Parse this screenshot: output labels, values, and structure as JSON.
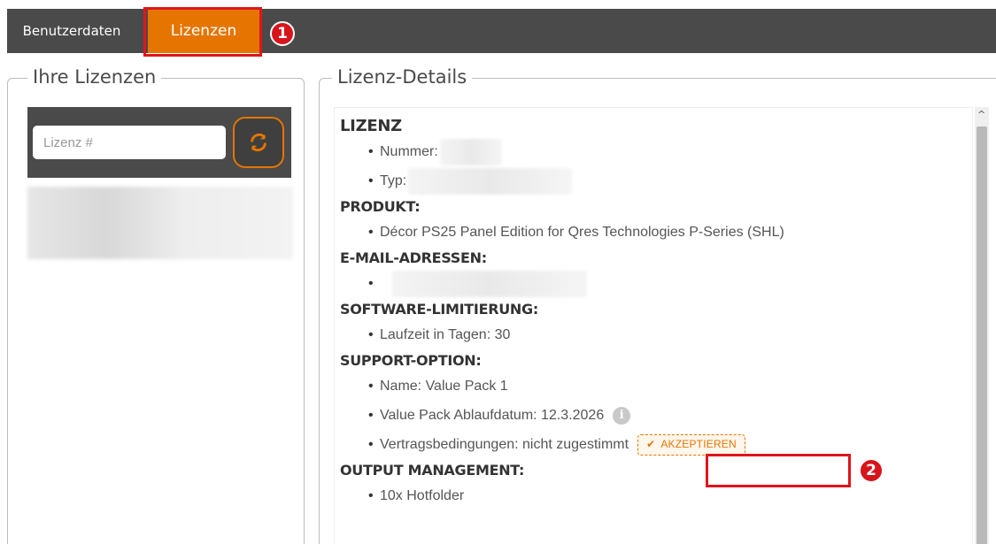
{
  "tabs": {
    "user_data": "Benutzerdaten",
    "licenses": "Lizenzen"
  },
  "markers": {
    "one": "1",
    "two": "2"
  },
  "left_panel": {
    "legend": "Ihre Lizenzen",
    "search_placeholder": "Lizenz #",
    "refresh_icon": "refresh-icon"
  },
  "right_panel": {
    "legend": "Lizenz-Details",
    "license": {
      "title": "LIZENZ",
      "number_label": "Nummer:",
      "type_label": "Typ:"
    },
    "product": {
      "title": "PRODUKT:",
      "name": "Décor PS25 Panel Edition for Qres Technologies P-Series (SHL)"
    },
    "emails": {
      "title": "E-MAIL-ADRESSEN:"
    },
    "software_limit": {
      "title": "SOFTWARE-LIMITIERUNG:",
      "runtime": "Laufzeit in Tagen: 30"
    },
    "support": {
      "title": "SUPPORT-OPTION:",
      "name": "Name: Value Pack 1",
      "expiry": "Value Pack Ablaufdatum: 12.3.2026",
      "terms": "Vertragsbedingungen: nicht zugestimmt",
      "accept_label": "AKZEPTIEREN",
      "check_icon": "✔"
    },
    "output": {
      "title": "OUTPUT MANAGEMENT:",
      "hotfolder": "10x Hotfolder"
    }
  },
  "colors": {
    "accent": "#e57500",
    "topbar": "#4a4a4a",
    "highlight": "#e0151b"
  }
}
